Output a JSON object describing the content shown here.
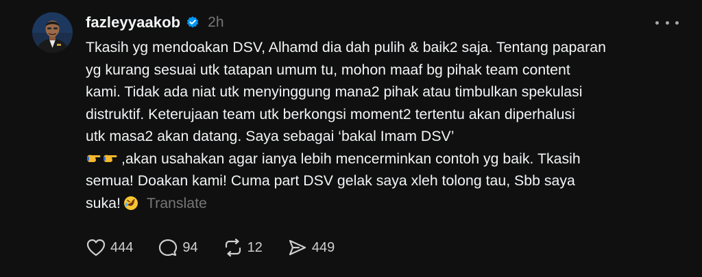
{
  "post": {
    "username": "fazleyyaakob",
    "time": "2h",
    "lines": [
      "Tkasih yg mendoakan DSV, Alhamd dia dah pulih & baik2 saja. Tentang paparan",
      "yg kurang sesuai utk tatapan umum tu, mohon maaf bg pihak team content",
      "kami. Tidak ada niat utk menyinggung mana2 pihak atau timbulkan spekulasi",
      "distruktif. Keterujaan team utk berkongsi moment2 tertentu akan diperhalusi",
      "utk masa2 akan datang. Saya sebagai ‘bakal Imam DSV’",
      ",akan usahakan agar ianya lebih mencerminkan contoh yg baik. Tkasih",
      "semua! Doakan kami! Cuma part DSV gelak saya xleh tolong tau, Sbb saya",
      "suka!"
    ],
    "translate_label": "Translate"
  },
  "actions": {
    "likes": "444",
    "comments": "94",
    "reposts": "12",
    "shares": "449"
  },
  "colors": {
    "background": "#101010",
    "text": "#f3f5f7",
    "muted": "#777777",
    "verified": "#0095f6"
  },
  "icons": {
    "verified": "verified-badge-icon",
    "more": "more-options-icon",
    "like": "heart-icon",
    "comment": "comment-bubble-icon",
    "repost": "repost-arrows-icon",
    "share": "send-arrow-icon",
    "emoji_point": "pointing-hands-emoji",
    "emoji_laugh": "rolling-laughing-emoji"
  }
}
